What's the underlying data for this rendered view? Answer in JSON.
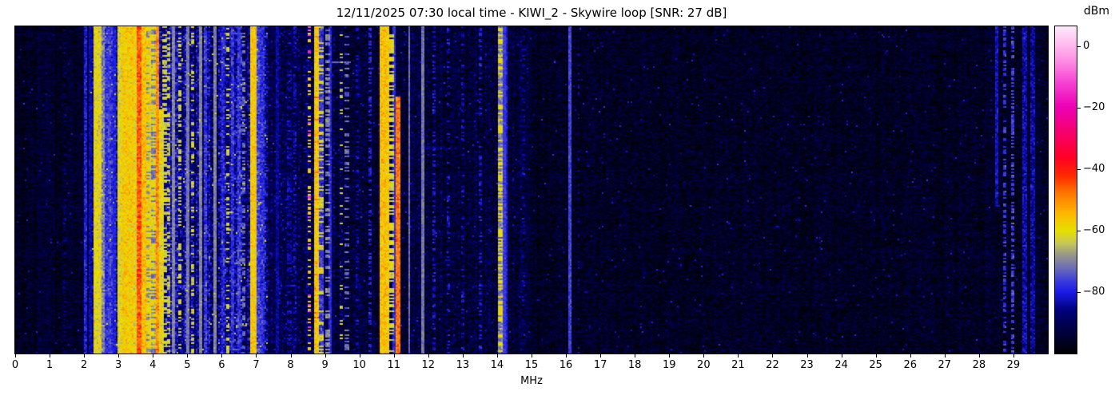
{
  "header": {
    "datetime_local": "12/11/2025 07:30",
    "station": "KIWI_2",
    "antenna": "Skywire loop",
    "snr_db": 27
  },
  "chart_data": {
    "type": "heatmap",
    "kind": "radio-spectrogram-waterfall",
    "title": "12/11/2025 07:30 local time - KIWI_2 - Skywire loop [SNR: 27 dB]",
    "xlabel": "MHz",
    "xlim": [
      0,
      30
    ],
    "x_ticks": [
      0,
      1,
      2,
      3,
      4,
      5,
      6,
      7,
      8,
      9,
      10,
      11,
      12,
      13,
      14,
      15,
      16,
      17,
      18,
      19,
      20,
      21,
      22,
      23,
      24,
      25,
      26,
      27,
      28,
      29
    ],
    "grid": false,
    "seed": 1337,
    "colorbar": {
      "label": "dBm",
      "vmin": -99.9,
      "vmax": 6.4,
      "tick_values": [
        0,
        -20,
        -40,
        -60,
        -80
      ],
      "tick_labels": [
        "0",
        "−20",
        "−40",
        "−60",
        "−80"
      ],
      "position": "right",
      "colormap_stops": [
        [
          -100,
          "#000000"
        ],
        [
          -93,
          "#00003c"
        ],
        [
          -86,
          "#00007a"
        ],
        [
          -80,
          "#1a1ae6"
        ],
        [
          -76,
          "#4040d8"
        ],
        [
          -72,
          "#6e6eb4"
        ],
        [
          -68,
          "#96968c"
        ],
        [
          -64,
          "#c8c855"
        ],
        [
          -60,
          "#e6e000"
        ],
        [
          -54,
          "#ffb400"
        ],
        [
          -48,
          "#ff7800"
        ],
        [
          -42,
          "#ff2800"
        ],
        [
          -36,
          "#ff0028"
        ],
        [
          -28,
          "#f6006e"
        ],
        [
          -20,
          "#eb00b4"
        ],
        [
          -12,
          "#f542d2"
        ],
        [
          -4,
          "#ff96e6"
        ],
        [
          2,
          "#ffc8f2"
        ],
        [
          6.4,
          "#ffeafc"
        ]
      ]
    },
    "noise_zones": [
      {
        "f0": 0.0,
        "f1": 2.2,
        "floor_dbm": -95.5,
        "sigma": 2.8,
        "col_sigma": 1.2,
        "row_factor": 0.3,
        "speck_p": 0.004,
        "speck_dbm": -84
      },
      {
        "f0": 2.2,
        "f1": 7.32,
        "floor_dbm": -86.5,
        "sigma": 5.0,
        "col_sigma": 3.5,
        "row_factor": 1.0,
        "speck_p": 0.012,
        "speck_dbm": -63
      },
      {
        "f0": 7.32,
        "f1": 9.3,
        "floor_dbm": -92.0,
        "sigma": 4.0,
        "col_sigma": 1.8,
        "row_factor": 0.5,
        "speck_p": 0.008,
        "speck_dbm": -80
      },
      {
        "f0": 9.3,
        "f1": 15.0,
        "floor_dbm": -93.5,
        "sigma": 3.5,
        "col_sigma": 1.5,
        "row_factor": 0.4,
        "speck_p": 0.006,
        "speck_dbm": -81
      },
      {
        "f0": 15.0,
        "f1": 30.0,
        "floor_dbm": -96.0,
        "sigma": 3.0,
        "col_sigma": 0.8,
        "row_factor": 0.3,
        "speck_p": 0.004,
        "speck_dbm": -84
      }
    ],
    "signals": [
      {
        "f0": 1.42,
        "f1": 1.46,
        "db": -88,
        "style": "dotted",
        "duty": 0.3
      },
      {
        "f0": 2.0,
        "f1": 2.07,
        "db": -80,
        "style": "rough"
      },
      {
        "f0": 2.14,
        "f1": 2.19,
        "db": -83,
        "style": "solid"
      },
      {
        "f0": 2.29,
        "f1": 2.36,
        "db": -60,
        "style": "rough"
      },
      {
        "f0": 2.4,
        "f1": 2.48,
        "db": -61,
        "style": "rough"
      },
      {
        "f0": 2.55,
        "f1": 2.6,
        "db": -70,
        "style": "rough"
      },
      {
        "f0": 2.62,
        "f1": 2.7,
        "db": -79,
        "style": "rough"
      },
      {
        "f0": 2.72,
        "f1": 2.8,
        "db": -78,
        "style": "rough"
      },
      {
        "f0": 2.86,
        "f1": 2.9,
        "db": -80,
        "style": "solid"
      },
      {
        "f0": 2.98,
        "f1": 3.13,
        "db": -61,
        "style": "rough"
      },
      {
        "f0": 3.13,
        "f1": 3.42,
        "db": -57,
        "style": "rough"
      },
      {
        "f0": 3.42,
        "f1": 3.53,
        "db": -60,
        "style": "rough"
      },
      {
        "f0": 3.53,
        "f1": 3.66,
        "db": -46,
        "style": "rough",
        "hot_p": 0.15,
        "hot_boost": 4
      },
      {
        "f0": 3.66,
        "f1": 3.78,
        "db": -56,
        "style": "rough"
      },
      {
        "f0": 3.78,
        "f1": 3.92,
        "db": -59,
        "style": "rough",
        "alt_db": -69,
        "alt_p": 0.3
      },
      {
        "f0": 3.92,
        "f1": 4.07,
        "db": -61,
        "style": "rough",
        "alt_db": -71,
        "alt_p": 0.35
      },
      {
        "f0": 4.11,
        "f1": 4.16,
        "db": -50,
        "style": "rough"
      },
      {
        "f0": 4.19,
        "f1": 4.28,
        "db": -61,
        "style": "partial",
        "start_frac": 0.25,
        "jit": 3
      },
      {
        "f0": 4.3,
        "f1": 4.4,
        "db": -63,
        "style": "dashed",
        "duty": 0.5
      },
      {
        "f0": 4.42,
        "f1": 4.47,
        "db": -64,
        "style": "dashed",
        "duty": 0.45
      },
      {
        "f0": 4.58,
        "f1": 4.62,
        "db": -70,
        "style": "solid"
      },
      {
        "f0": 4.74,
        "f1": 4.79,
        "db": -63,
        "style": "dashed",
        "duty": 0.45
      },
      {
        "f0": 4.97,
        "f1": 5.02,
        "db": -71,
        "style": "solid"
      },
      {
        "f0": 5.14,
        "f1": 5.2,
        "db": -63,
        "style": "dashed",
        "duty": 0.4
      },
      {
        "f0": 5.36,
        "f1": 5.41,
        "db": -70,
        "style": "solid"
      },
      {
        "f0": 5.5,
        "f1": 5.56,
        "db": -78,
        "style": "rough"
      },
      {
        "f0": 5.78,
        "f1": 5.84,
        "db": -70,
        "style": "solid"
      },
      {
        "f0": 6.0,
        "f1": 6.06,
        "db": -79,
        "style": "rough"
      },
      {
        "f0": 6.14,
        "f1": 6.19,
        "db": -62,
        "style": "dotted",
        "duty": 0.35
      },
      {
        "f0": 6.3,
        "f1": 6.36,
        "db": -78,
        "style": "rough"
      },
      {
        "f0": 6.46,
        "f1": 6.54,
        "db": -77,
        "style": "rough"
      },
      {
        "f0": 6.62,
        "f1": 6.66,
        "db": -72,
        "style": "dashed",
        "duty": 0.5
      },
      {
        "f0": 6.84,
        "f1": 6.97,
        "db": -57,
        "style": "rough"
      },
      {
        "f0": 7.0,
        "f1": 7.06,
        "db": -76,
        "style": "rough"
      },
      {
        "f0": 7.14,
        "f1": 7.24,
        "db": -78,
        "style": "rough"
      },
      {
        "f0": 7.58,
        "f1": 7.62,
        "db": -84,
        "style": "solid"
      },
      {
        "f0": 7.94,
        "f1": 7.99,
        "db": -84,
        "style": "dotted",
        "duty": 0.4
      },
      {
        "f0": 8.1,
        "f1": 8.14,
        "db": -83,
        "style": "dotted",
        "duty": 0.35
      },
      {
        "f0": 8.52,
        "f1": 8.57,
        "db": -58,
        "style": "dotted",
        "duty": 0.35,
        "hot_p": 0.25,
        "hot_boost": 45
      },
      {
        "f0": 8.71,
        "f1": 8.79,
        "db": -57,
        "style": "rough",
        "hot_p": 0.1,
        "hot_boost": 8
      },
      {
        "f0": 8.83,
        "f1": 8.93,
        "db": -77,
        "style": "rough"
      },
      {
        "f0": 8.83,
        "f1": 8.93,
        "db": -62,
        "style": "dashed",
        "duty": 0.35
      },
      {
        "f0": 9.03,
        "f1": 9.12,
        "db": -70,
        "style": "dashed",
        "duty": 0.45
      },
      {
        "f0": 9.13,
        "f1": 9.18,
        "db": -79,
        "style": "solid"
      },
      {
        "f0": 9.45,
        "f1": 9.49,
        "db": -63,
        "style": "dotted",
        "duty": 0.2
      },
      {
        "f0": 9.6,
        "f1": 9.7,
        "db": -73,
        "style": "dashed",
        "duty": 0.3
      },
      {
        "f0": 9.9,
        "f1": 9.94,
        "db": -83,
        "style": "dotted",
        "duty": 0.3
      },
      {
        "f0": 10.3,
        "f1": 10.35,
        "db": -80,
        "style": "dotted",
        "duty": 0.45
      },
      {
        "f0": 10.63,
        "f1": 10.74,
        "db": -56,
        "style": "rough"
      },
      {
        "f0": 10.76,
        "f1": 10.85,
        "db": -57,
        "style": "rough"
      },
      {
        "f0": 10.91,
        "f1": 10.96,
        "db": -61,
        "style": "dashed",
        "duty": 0.55
      },
      {
        "f0": 10.98,
        "f1": 11.02,
        "db": -78,
        "style": "solid"
      },
      {
        "f0": 11.08,
        "f1": 11.18,
        "db": -48,
        "style": "partial",
        "start_frac": 0.21,
        "jit": 3
      },
      {
        "f0": 11.43,
        "f1": 11.47,
        "db": -72,
        "style": "solid"
      },
      {
        "f0": 11.8,
        "f1": 11.85,
        "db": -71,
        "style": "solid"
      },
      {
        "f0": 12.13,
        "f1": 12.17,
        "db": -81,
        "style": "dotted",
        "duty": 0.4
      },
      {
        "f0": 12.58,
        "f1": 12.62,
        "db": -82,
        "style": "dotted",
        "duty": 0.35
      },
      {
        "f0": 13.0,
        "f1": 13.04,
        "db": -83,
        "style": "dotted",
        "duty": 0.3
      },
      {
        "f0": 13.48,
        "f1": 13.52,
        "db": -81,
        "style": "dotted",
        "duty": 0.35
      },
      {
        "f0": 14.03,
        "f1": 14.15,
        "db": -70,
        "style": "rough",
        "alt_db": -59,
        "alt_p": 0.4
      },
      {
        "f0": 14.17,
        "f1": 14.23,
        "db": -77,
        "style": "solid"
      },
      {
        "f0": 14.25,
        "f1": 14.29,
        "db": -80,
        "style": "solid"
      },
      {
        "f0": 14.73,
        "f1": 14.77,
        "db": -85,
        "style": "dotted",
        "duty": 0.3
      },
      {
        "f0": 16.08,
        "f1": 16.12,
        "db": -76,
        "style": "solid"
      },
      {
        "f0": 16.35,
        "f1": 16.39,
        "db": -85,
        "style": "dotted",
        "duty": 0.3
      },
      {
        "f0": 28.48,
        "f1": 28.52,
        "db": -82,
        "style": "partial",
        "end_frac": 0.55
      },
      {
        "f0": 28.72,
        "f1": 28.78,
        "db": -77,
        "style": "dashed",
        "duty": 0.5
      },
      {
        "f0": 28.95,
        "f1": 29.02,
        "db": -76,
        "style": "dashed",
        "duty": 0.55
      },
      {
        "f0": 29.28,
        "f1": 29.38,
        "db": -83,
        "style": "rough"
      },
      {
        "f0": 29.52,
        "f1": 29.62,
        "db": -84,
        "style": "rough"
      }
    ],
    "artifacts": [
      {
        "type": "hline",
        "f0": 9.2,
        "f1": 9.75,
        "y_frac": 0.107,
        "db": -73,
        "row_span": 1
      },
      {
        "type": "hline",
        "f0": 11.75,
        "f1": 12.55,
        "y_frac": 0.368,
        "db": -87,
        "row_span": 2
      }
    ]
  }
}
